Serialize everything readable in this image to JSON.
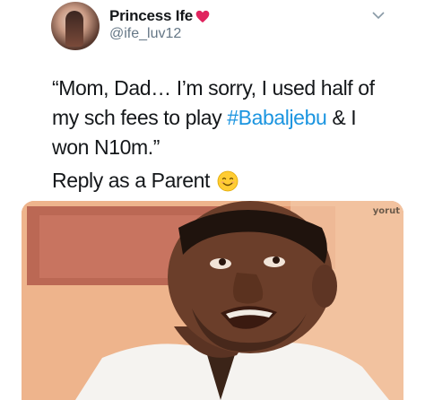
{
  "tweet": {
    "display_name": "Princess Ife",
    "handle": "@ife_luv12",
    "text_line1": "“Mom, Dad… I’m sorry, I used half of",
    "text_line2_before": "my sch fees to play ",
    "hashtag": "#Babaljebu",
    "text_line2_after": " & I",
    "text_line3": "won N10m.”",
    "reply_prompt": "Reply as a Parent",
    "reply_emoji": "smiling-face-emoji",
    "heart_icon": "red-heart-icon",
    "more_icon": "chevron-down-icon"
  },
  "media": {
    "watermark": "yorut"
  },
  "colors": {
    "text": "#14171a",
    "handle": "#657786",
    "hashtag": "#1b95e0",
    "heart": "#e0245e"
  }
}
